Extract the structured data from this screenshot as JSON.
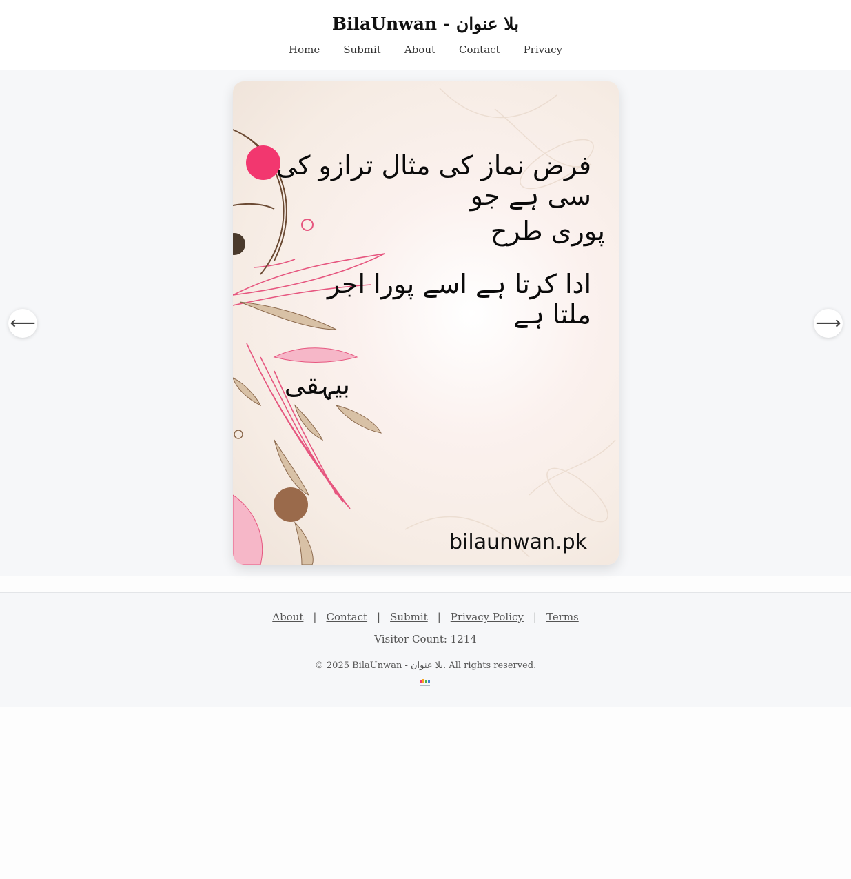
{
  "header": {
    "title": "BilaUnwan - بلا عنوان",
    "nav": [
      "Home",
      "Submit",
      "About",
      "Contact",
      "Privacy"
    ]
  },
  "slide": {
    "lines": [
      "فرض نماز کی مثال ترازو کی سی ہے جو",
      "پوری طرح",
      "ادا کرتا ہے اسے پورا اجر ملتا ہے",
      "بیہقی"
    ],
    "watermark": "bilaunwan.pk",
    "prev_icon": "⟵",
    "next_icon": "⟶"
  },
  "footer": {
    "links": [
      "About",
      "Contact",
      "Submit",
      "Privacy Policy",
      "Terms"
    ],
    "separator": "|",
    "visitor_count": "Visitor Count: 1214",
    "copyright": "© 2025 BilaUnwan - بلا عنوان. All rights reserved."
  },
  "icons": {
    "prev": "arrow-left-icon",
    "next": "arrow-right-icon",
    "logo": "bilaunwan-logo-icon"
  },
  "colors": {
    "accent_pink": "#f2376f",
    "brown_dot": "#9a6a4b",
    "dark_dot": "#4a3a2c"
  }
}
